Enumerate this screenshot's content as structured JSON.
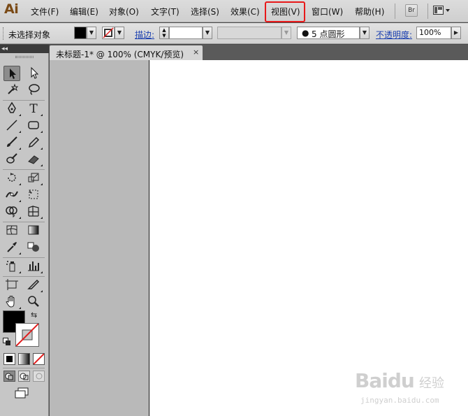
{
  "app": {
    "logo": "Ai"
  },
  "menu": {
    "items": [
      "文件(F)",
      "编辑(E)",
      "对象(O)",
      "文字(T)",
      "选择(S)",
      "效果(C)",
      "视图(V)",
      "窗口(W)",
      "帮助(H)"
    ],
    "highlighted": "视图(V)",
    "highlight_color": "#e8191a"
  },
  "toolbar_buttons": {
    "bridge": "Br",
    "workspace": "workspace-switcher-icon"
  },
  "control_bar": {
    "selection_status": "未选择对象",
    "fill_color": "#000000",
    "stroke_label": "描边:",
    "brush_value": "5 点圆形",
    "opacity_label": "不透明度:",
    "opacity_value": "100%"
  },
  "tools_panel": {
    "collapse_glyph": "◂◂"
  },
  "document": {
    "tab_title": "未标题-1* @ 100% (CMYK/预览)",
    "tab_close": "×"
  },
  "watermark": {
    "brand": "Baidu",
    "cn": "经验",
    "url": "jingyan.baidu.com"
  }
}
